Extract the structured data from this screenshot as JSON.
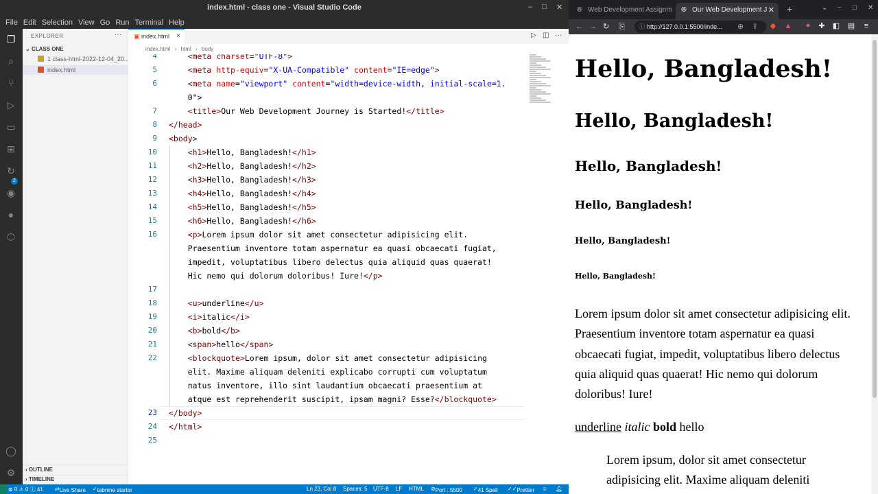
{
  "vscode": {
    "window_title": "index.html - class one - Visual Studio Code",
    "window_controls": [
      "–",
      "□",
      "✕"
    ],
    "menu": [
      "File",
      "Edit",
      "Selection",
      "View",
      "Go",
      "Run",
      "Terminal",
      "Help"
    ],
    "activity_badge": "2",
    "sidebar": {
      "header": "EXPLORER",
      "folder": "CLASS ONE",
      "files": [
        {
          "label": "1 class-html-2022-12-04_20...",
          "color": "#c9a227"
        },
        {
          "label": "index.html",
          "color": "#e44d26"
        }
      ],
      "outline": "OUTLINE",
      "timeline": "TIMELINE"
    },
    "tab": {
      "label": "index.html",
      "close": "×"
    },
    "breadcrumb": [
      "index.html",
      "›",
      "html",
      "›",
      "body"
    ],
    "editor": {
      "line_numbers": [
        "4",
        "5",
        "6",
        "",
        "7",
        "8",
        "9",
        "10",
        "11",
        "12",
        "13",
        "14",
        "15",
        "16",
        "",
        "",
        "",
        "17",
        "18",
        "19",
        "20",
        "21",
        "22",
        "",
        "",
        "",
        "23",
        "24",
        "25"
      ],
      "current_line": "23",
      "lines": [
        "    <meta charset=\"UTF-8\">",
        "    <meta http-equiv=\"X-UA-Compatible\" content=\"IE=edge\">",
        "    <meta name=\"viewport\" content=\"width=device-width, initial-scale=1.",
        "    0\">",
        "    <title>Our Web Development Journey is Started!</title>",
        "</head>",
        "<body>",
        "    <h1>Hello, Bangladesh!</h1>",
        "    <h2>Hello, Bangladesh!</h2>",
        "    <h3>Hello, Bangladesh!</h3>",
        "    <h4>Hello, Bangladesh!</h4>",
        "    <h5>Hello, Bangladesh!</h5>",
        "    <h6>Hello, Bangladesh!</h6>",
        "    <p>Lorem ipsum dolor sit amet consectetur adipisicing elit.",
        "    Praesentium inventore totam aspernatur ea quasi obcaecati fugiat,",
        "    impedit, voluptatibus libero delectus quia aliquid quas quaerat!",
        "    Hic nemo qui dolorum doloribus! Iure!</p>",
        "",
        "    <u>underline</u>",
        "    <i>italic</i>",
        "    <b>bold</b>",
        "    <span>hello</span>",
        "    <blockquote>Lorem ipsum, dolor sit amet consectetur adipisicing",
        "    elit. Maxime aliquam deleniti explicabo corrupti cum voluptatum",
        "    natus inventore, illo sint laudantium obcaecati praesentium at",
        "    atque est reprehenderit suscipit, ipsam magni? Esse?</blockquote>",
        "</body>",
        "</html>",
        ""
      ]
    },
    "status": {
      "errors": "⊗ 0 ⚠ 0 ⓘ 41",
      "live_share": "Live Share",
      "tabnine": "tabnine starter",
      "position": "Ln 23, Col 8",
      "spaces": "Spaces: 5",
      "encoding": "UTF-8",
      "eol": "LF",
      "language": "HTML",
      "port": "Port : 5500",
      "spell": "41 Spell",
      "prettier": "Prettier"
    }
  },
  "browser": {
    "tabs": [
      {
        "label": "Web Development Assignm",
        "active": false
      },
      {
        "label": "Our Web Development J",
        "active": true
      }
    ],
    "new_tab": "+",
    "window_controls": [
      "⌄",
      "–",
      "□",
      "✕"
    ],
    "url": "http://127.0.0.1:5500/inde...",
    "page": {
      "h1": "Hello, Bangladesh!",
      "h2": "Hello, Bangladesh!",
      "h3": "Hello, Bangladesh!",
      "h4": "Hello, Bangladesh!",
      "h5": "Hello, Bangladesh!",
      "h6": "Hello, Bangladesh!",
      "paragraph": "Lorem ipsum dolor sit amet consectetur adipisicing elit. Praesentium inventore totam aspernatur ea quasi obcaecati fugiat, impedit, voluptatibus libero delectus quia aliquid quas quaerat! Hic nemo qui dolorum doloribus! Iure!",
      "underline": "underline",
      "italic": "italic",
      "bold": "bold",
      "span": "hello",
      "blockquote": "Lorem ipsum, dolor sit amet consectetur adipisicing elit. Maxime aliquam deleniti"
    }
  }
}
